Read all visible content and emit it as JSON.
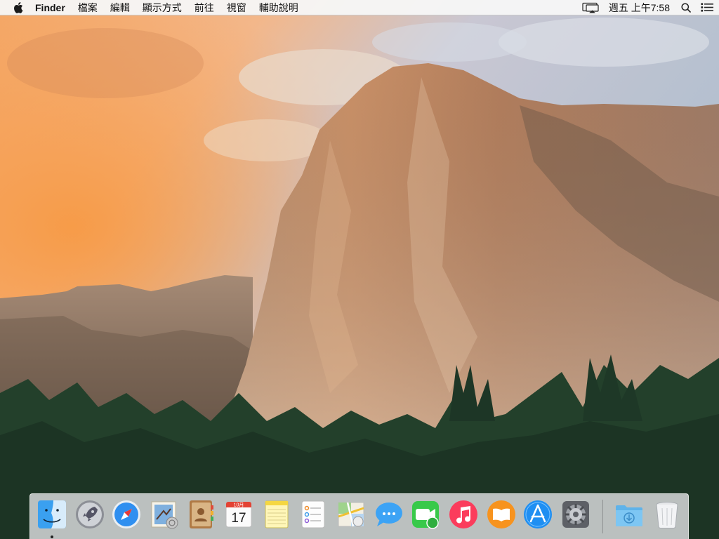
{
  "menubar": {
    "app_name": "Finder",
    "menus": [
      "檔案",
      "編輯",
      "顯示方式",
      "前往",
      "視窗",
      "輔助說明"
    ],
    "clock": "週五 上午7:58"
  },
  "dock": {
    "apps": [
      {
        "name": "Finder",
        "icon": "finder-icon",
        "running": true
      },
      {
        "name": "Launchpad",
        "icon": "launchpad-icon"
      },
      {
        "name": "Safari",
        "icon": "safari-icon"
      },
      {
        "name": "Mail",
        "icon": "mail-icon"
      },
      {
        "name": "Contacts",
        "icon": "contacts-icon"
      },
      {
        "name": "Calendar",
        "icon": "calendar-icon",
        "month": "10月",
        "day": "17"
      },
      {
        "name": "Notes",
        "icon": "notes-icon"
      },
      {
        "name": "Reminders",
        "icon": "reminders-icon"
      },
      {
        "name": "Maps",
        "icon": "maps-icon"
      },
      {
        "name": "Messages",
        "icon": "messages-icon"
      },
      {
        "name": "FaceTime",
        "icon": "facetime-icon"
      },
      {
        "name": "iTunes",
        "icon": "itunes-icon"
      },
      {
        "name": "iBooks",
        "icon": "ibooks-icon"
      },
      {
        "name": "App Store",
        "icon": "app-store-icon"
      },
      {
        "name": "System Preferences",
        "icon": "system-preferences-icon"
      }
    ],
    "folders": [
      {
        "name": "Downloads",
        "icon": "downloads-folder-icon"
      },
      {
        "name": "Trash",
        "icon": "trash-icon"
      }
    ]
  }
}
